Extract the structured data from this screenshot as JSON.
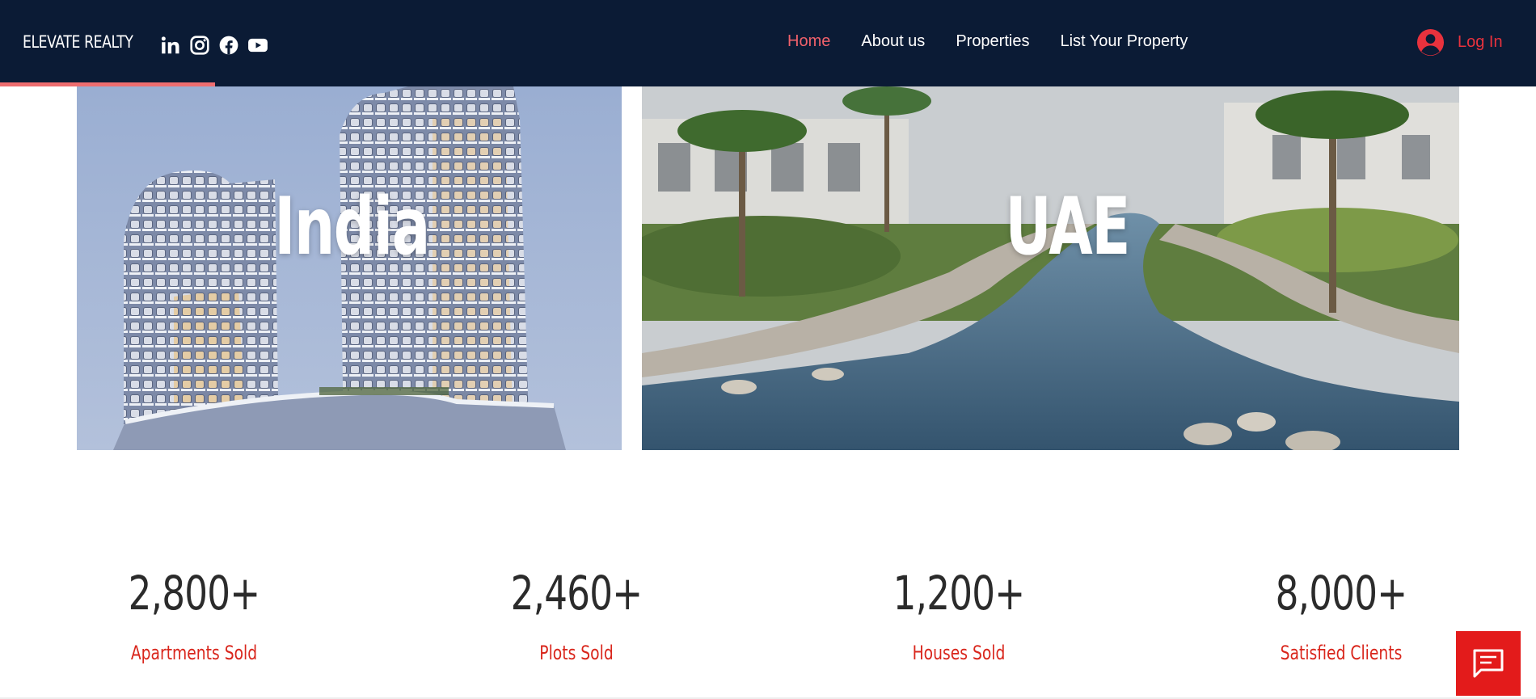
{
  "header": {
    "brand": "ELEVATE REALTY",
    "social": [
      "linkedin-icon",
      "instagram-icon",
      "facebook-icon",
      "youtube-icon"
    ],
    "nav": [
      {
        "label": "Home",
        "active": true
      },
      {
        "label": "About us",
        "active": false
      },
      {
        "label": "Properties",
        "active": false
      },
      {
        "label": "List Your Property",
        "active": false
      }
    ],
    "login_label": "Log In",
    "scroll_progress": 0.14
  },
  "regions": [
    {
      "title": "India"
    },
    {
      "title": "UAE"
    }
  ],
  "stats": [
    {
      "value": "2,800+",
      "label": "Apartments Sold"
    },
    {
      "value": "2,460+",
      "label": "Plots Sold"
    },
    {
      "value": "1,200+",
      "label": "Houses Sold"
    },
    {
      "value": "8,000+",
      "label": "Satisfied Clients"
    }
  ],
  "chat": {
    "icon": "chat-icon"
  },
  "colors": {
    "header_bg": "#0b1b35",
    "accent": "#f0616b",
    "login": "#e8323d",
    "stat_label": "#d9261c",
    "chat_bg": "#e31b1b"
  }
}
